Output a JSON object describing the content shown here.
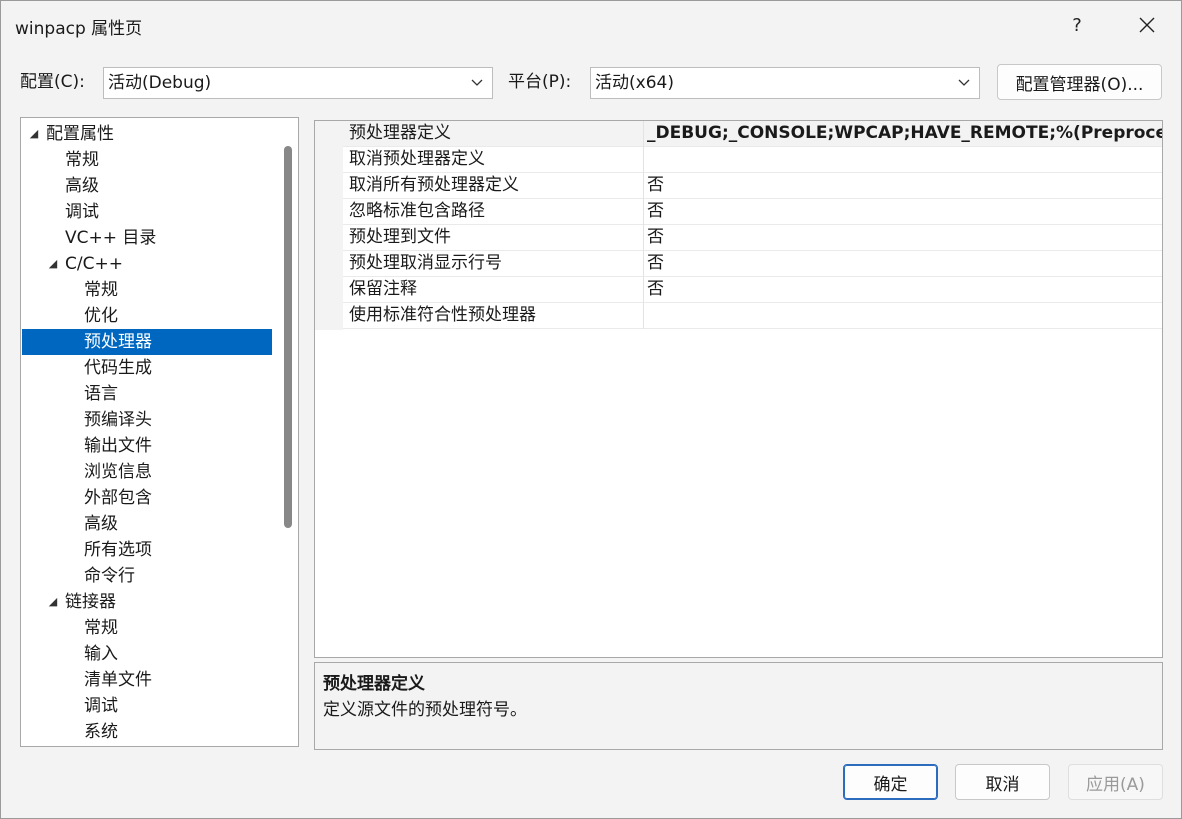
{
  "window": {
    "title": "winpacp 属性页"
  },
  "titlebar": {
    "help_label": "?",
    "close_label": "✕"
  },
  "config": {
    "config_label": "配置(C):",
    "config_value": "活动(Debug)",
    "platform_label": "平台(P):",
    "platform_value": "活动(x64)",
    "manager_button": "配置管理器(O)..."
  },
  "tree": {
    "items": [
      {
        "label": "配置属性",
        "arrow": "◢"
      },
      {
        "label": "常规"
      },
      {
        "label": "高级"
      },
      {
        "label": "调试"
      },
      {
        "label": "VC++ 目录"
      },
      {
        "label": "C/C++",
        "arrow": "◢"
      },
      {
        "label": "常规"
      },
      {
        "label": "优化"
      },
      {
        "label": "预处理器",
        "selected": true
      },
      {
        "label": "代码生成"
      },
      {
        "label": "语言"
      },
      {
        "label": "预编译头"
      },
      {
        "label": "输出文件"
      },
      {
        "label": "浏览信息"
      },
      {
        "label": "外部包含"
      },
      {
        "label": "高级"
      },
      {
        "label": "所有选项"
      },
      {
        "label": "命令行"
      },
      {
        "label": "链接器",
        "arrow": "◢"
      },
      {
        "label": "常规"
      },
      {
        "label": "输入"
      },
      {
        "label": "清单文件"
      },
      {
        "label": "调试"
      },
      {
        "label": "系统"
      }
    ]
  },
  "grid": {
    "rows": [
      {
        "name": "预处理器定义",
        "value": "_DEBUG;_CONSOLE;WPCAP;HAVE_REMOTE;%(Preprocess"
      },
      {
        "name": "取消预处理器定义",
        "value": ""
      },
      {
        "name": "取消所有预处理器定义",
        "value": "否"
      },
      {
        "name": "忽略标准包含路径",
        "value": "否"
      },
      {
        "name": "预处理到文件",
        "value": "否"
      },
      {
        "name": "预处理取消显示行号",
        "value": "否"
      },
      {
        "name": "保留注释",
        "value": "否"
      },
      {
        "name": "使用标准符合性预处理器",
        "value": ""
      }
    ]
  },
  "description": {
    "title": "预处理器定义",
    "text": "定义源文件的预处理符号。"
  },
  "footer": {
    "ok_label": "确定",
    "cancel_label": "取消",
    "apply_label": "应用(A)"
  },
  "colors": {
    "accent": "#0067c0",
    "background": "#f3f3f3"
  }
}
